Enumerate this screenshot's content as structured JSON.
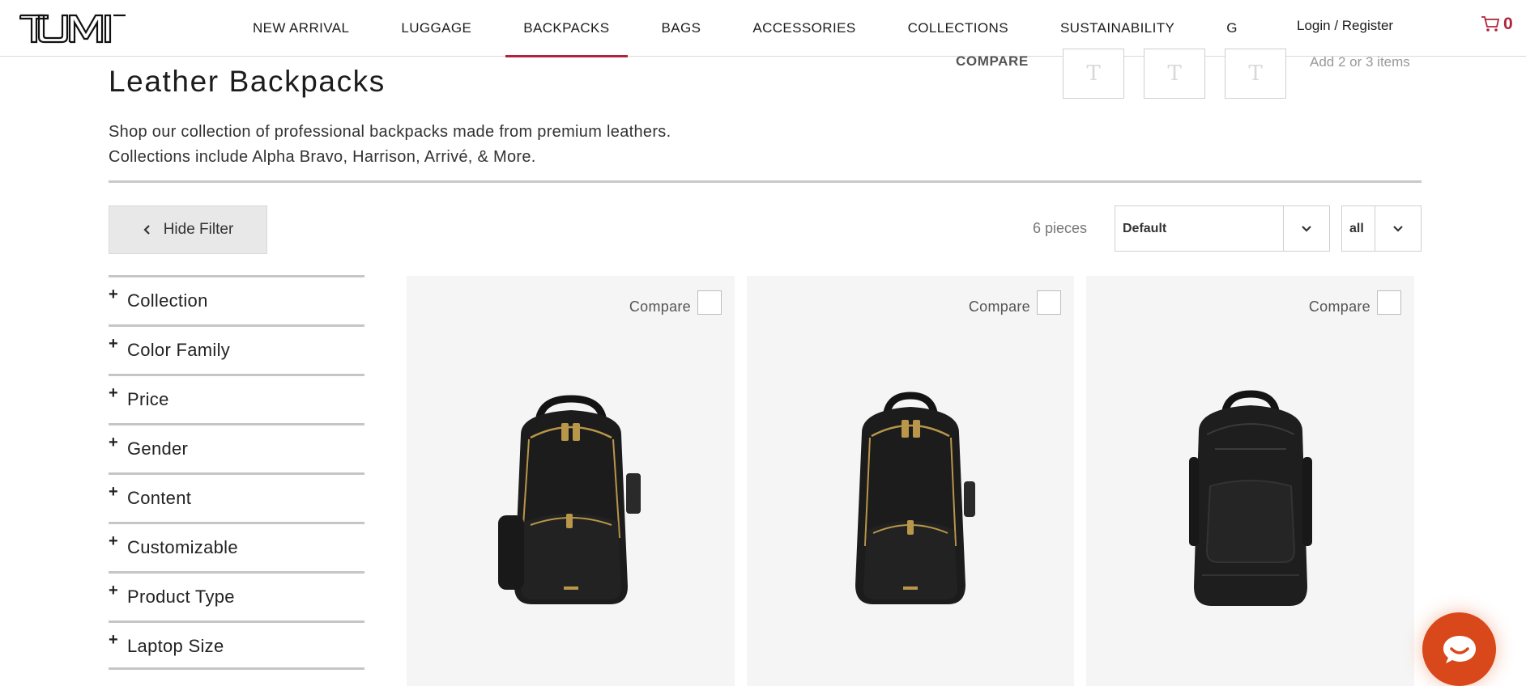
{
  "header": {
    "brand": "TUMI",
    "nav": [
      {
        "label": "NEW ARRIVAL",
        "active": false
      },
      {
        "label": "LUGGAGE",
        "active": false
      },
      {
        "label": "BACKPACKS",
        "active": true
      },
      {
        "label": "BAGS",
        "active": false
      },
      {
        "label": "ACCESSORIES",
        "active": false
      },
      {
        "label": "COLLECTIONS",
        "active": false
      },
      {
        "label": "SUSTAINABILITY",
        "active": false
      },
      {
        "label": "G",
        "active": false
      }
    ],
    "login": "Login / Register",
    "cart_count": "0",
    "cart_icon": "cart-icon"
  },
  "page": {
    "title": "Leather Backpacks",
    "description_line1": "Shop our collection of professional backpacks made from premium leathers.",
    "description_line2": "Collections include Alpha Bravo, Harrison, Arrivé, & More."
  },
  "compare": {
    "label": "COMPARE",
    "slot_glyph": "T",
    "hint": "Add 2 or 3 items"
  },
  "toolbar": {
    "hide_filter": "Hide Filter",
    "pieces": "6 pieces",
    "sort_value": "Default",
    "per_page_value": "all"
  },
  "filters": [
    {
      "label": "Collection"
    },
    {
      "label": "Color Family"
    },
    {
      "label": "Price"
    },
    {
      "label": "Gender"
    },
    {
      "label": "Content"
    },
    {
      "label": "Customizable"
    },
    {
      "label": "Product Type"
    },
    {
      "label": "Laptop Size"
    }
  ],
  "products": [
    {
      "compare_label": "Compare",
      "image": "black leather backpack with gold zippers and front pocket"
    },
    {
      "compare_label": "Compare",
      "image": "black leather backpack with gold zippers"
    },
    {
      "compare_label": "Compare",
      "image": "black leather backpack with dark hardware"
    }
  ],
  "colors": {
    "accent": "#b0243b",
    "chat": "#d8481a"
  }
}
